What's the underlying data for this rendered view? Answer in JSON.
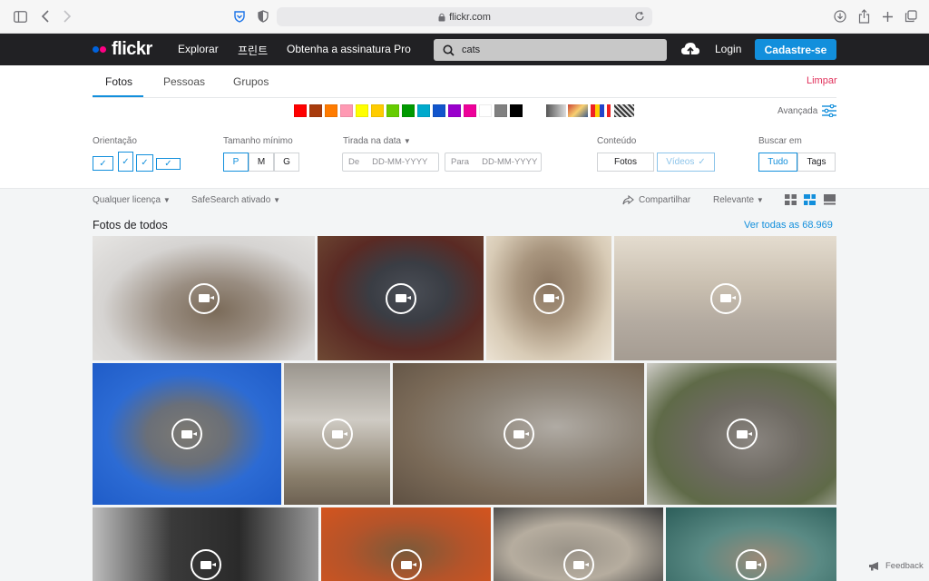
{
  "browser": {
    "url": "flickr.com"
  },
  "header": {
    "logo": "flickr",
    "nav": [
      "Explorar",
      "프린트",
      "Obtenha a assinatura Pro"
    ],
    "search_value": "cats",
    "login": "Login",
    "signup": "Cadastre-se"
  },
  "tabs": [
    "Fotos",
    "Pessoas",
    "Grupos"
  ],
  "clear_label": "Limpar",
  "colors": [
    "#ff0000",
    "#a83b0c",
    "#ff7b00",
    "#ff99b3",
    "#ffff00",
    "#ffcc00",
    "#66cc00",
    "#009900",
    "#00aacc",
    "#1155cc",
    "#9900cc",
    "#ee0099",
    "#ffffff",
    "#808080",
    "#000000"
  ],
  "advanced_label": "Avançada",
  "filters": {
    "orientation_label": "Orientação",
    "size_label": "Tamanho mínimo",
    "sizes": [
      "P",
      "M",
      "G"
    ],
    "date_label": "Tirada na data",
    "date_from": "De",
    "date_to": "Para",
    "date_placeholder": "DD-MM-YYYY",
    "content_label": "Conteúdo",
    "content_options": [
      "Fotos",
      "Vídeos"
    ],
    "search_in_label": "Buscar em",
    "search_in_options": [
      "Tudo",
      "Tags"
    ]
  },
  "subbar": {
    "license": "Qualquer licença",
    "safesearch": "SafeSearch ativado",
    "share": "Compartilhar",
    "sort": "Relevante"
  },
  "section": {
    "title": "Fotos de todos",
    "see_all": "Ver todas as 68.969"
  },
  "feedback": "Feedback"
}
